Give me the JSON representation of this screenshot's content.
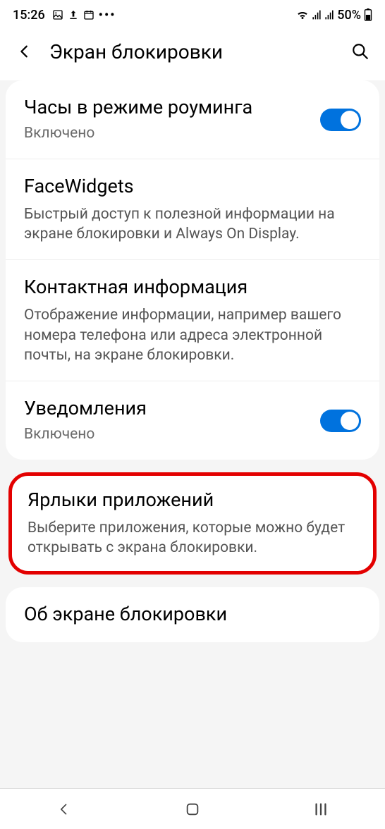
{
  "status": {
    "time": "15:26",
    "battery": "50%"
  },
  "header": {
    "title": "Экран блокировки"
  },
  "items": {
    "roaming_clock": {
      "title": "Часы в режиме роуминга",
      "sub": "Включено"
    },
    "facewidgets": {
      "title": "FaceWidgets",
      "desc": "Быстрый доступ к полезной информации на экране блокировки и Always On Display."
    },
    "contact_info": {
      "title": "Контактная информация",
      "desc": "Отображение информации, например вашего номера телефона или адреса электронной почты, на экране блокировки."
    },
    "notifications": {
      "title": "Уведомления",
      "sub": "Включено"
    },
    "app_shortcuts": {
      "title": "Ярлыки приложений",
      "desc": "Выберите приложения, которые можно будет открывать с экрана блокировки."
    },
    "about": {
      "title": "Об экране блокировки"
    }
  }
}
